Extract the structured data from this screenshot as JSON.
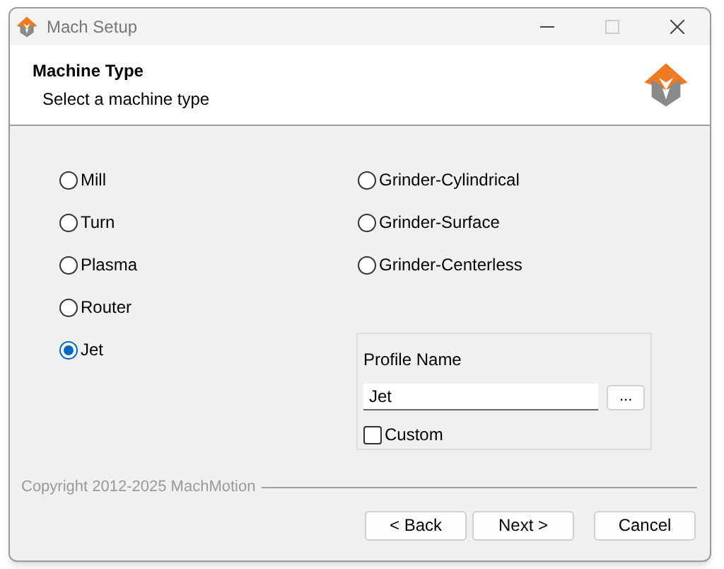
{
  "window": {
    "title": "Mach Setup",
    "maximize_disabled": true
  },
  "header": {
    "title": "Machine Type",
    "subtitle": "Select a machine type"
  },
  "machine_types_left": [
    {
      "label": "Mill",
      "selected": false
    },
    {
      "label": "Turn",
      "selected": false
    },
    {
      "label": "Plasma",
      "selected": false
    },
    {
      "label": "Router",
      "selected": false
    },
    {
      "label": "Jet",
      "selected": true
    }
  ],
  "machine_types_right": [
    {
      "label": "Grinder-Cylindrical",
      "selected": false
    },
    {
      "label": "Grinder-Surface",
      "selected": false
    },
    {
      "label": "Grinder-Centerless",
      "selected": false
    }
  ],
  "profile": {
    "label": "Profile Name",
    "value": "Jet",
    "browse_button": "...",
    "custom": {
      "label": "Custom",
      "checked": false
    }
  },
  "copyright": "Copyright 2012-2025 MachMotion",
  "buttons": [
    "< Back",
    "Next >",
    "Cancel"
  ]
}
